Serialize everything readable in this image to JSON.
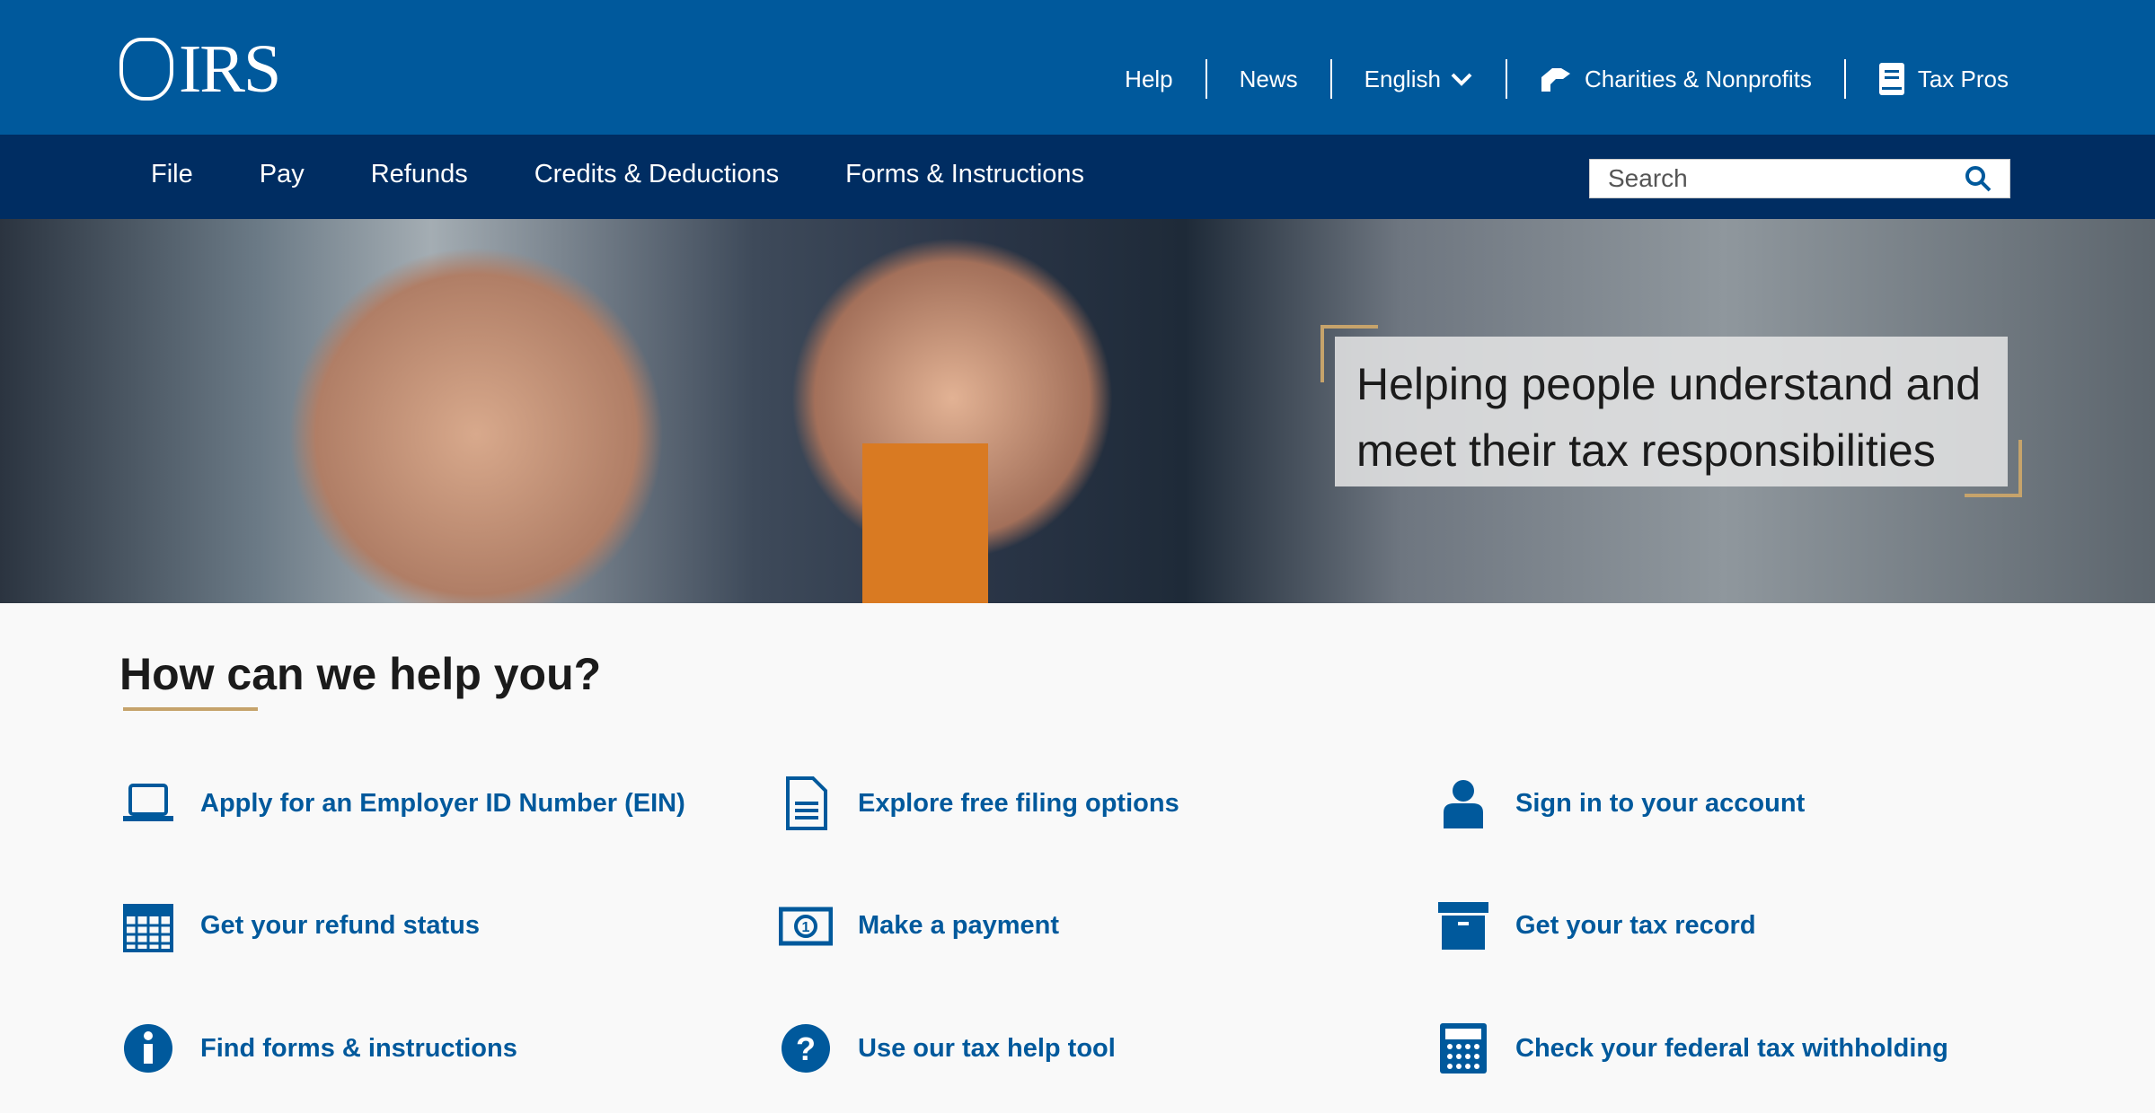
{
  "header": {
    "logo_text": "IRS",
    "utility_links": [
      "Help",
      "News",
      "English",
      "Charities & Nonprofits",
      "Tax Pros"
    ]
  },
  "nav": {
    "items": [
      "File",
      "Pay",
      "Refunds",
      "Credits & Deductions",
      "Forms & Instructions"
    ],
    "search_placeholder": "Search"
  },
  "hero": {
    "caption": "Helping people understand and meet their tax responsibilities"
  },
  "help": {
    "heading": "How can we help you?",
    "tasks": [
      {
        "label": "Apply for an Employer ID Number (EIN)",
        "icon": "laptop-icon"
      },
      {
        "label": "Explore free filing options",
        "icon": "document-icon"
      },
      {
        "label": "Sign in to your account",
        "icon": "user-icon"
      },
      {
        "label": "Get your refund status",
        "icon": "calendar-icon"
      },
      {
        "label": "Make a payment",
        "icon": "money-icon"
      },
      {
        "label": "Get your tax record",
        "icon": "archive-icon"
      },
      {
        "label": "Find forms & instructions",
        "icon": "info-icon"
      },
      {
        "label": "Use our tax help tool",
        "icon": "question-icon"
      },
      {
        "label": "Check your federal tax withholding",
        "icon": "calculator-icon"
      }
    ]
  },
  "colors": {
    "primary": "#00599c",
    "nav": "#002d62",
    "accent": "#c6a36b"
  }
}
